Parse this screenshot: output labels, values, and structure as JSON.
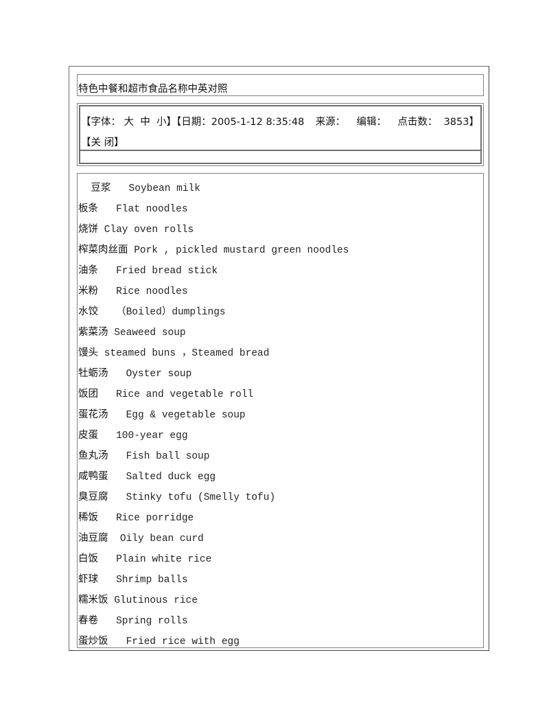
{
  "title": "特色中餐和超市食品名称中英对照",
  "meta": {
    "font_label_open": "【字体：",
    "font_large": "大",
    "font_medium": "中",
    "font_small": "小",
    "font_label_close": "】",
    "date_label": "【日期：2005-1-12 8:35:48",
    "source_label": "来源：",
    "editor_label": "编辑：",
    "clicks_label": "点击数：",
    "clicks_value": "3853】",
    "close_label": "【关 闭】"
  },
  "items": [
    {
      "zh": "    豆浆",
      "gap": "   ",
      "en": "Soybean milk"
    },
    {
      "zh": "板条",
      "gap": "   ",
      "en": "Flat noodles"
    },
    {
      "zh": "烧饼",
      "gap": " ",
      "en": "Clay oven rolls"
    },
    {
      "zh": "榨菜肉丝面",
      "gap": " ",
      "en": "Pork , pickled mustard green noodles"
    },
    {
      "zh": "油条",
      "gap": "   ",
      "en": "Fried bread stick"
    },
    {
      "zh": "米粉",
      "gap": "   ",
      "en": "Rice noodles"
    },
    {
      "zh": "水饺",
      "gap": "   ",
      "en": "（Boiled）dumplings"
    },
    {
      "zh": "紫菜汤",
      "gap": " ",
      "en": "Seaweed soup"
    },
    {
      "zh": "馒头",
      "gap": " ",
      "en": "steamed buns ，Steamed bread"
    },
    {
      "zh": "牡蛎汤",
      "gap": "   ",
      "en": "Oyster soup"
    },
    {
      "zh": "饭团",
      "gap": "   ",
      "en": "Rice and vegetable roll"
    },
    {
      "zh": "蛋花汤",
      "gap": "   ",
      "en": "Egg & vegetable soup"
    },
    {
      "zh": "皮蛋",
      "gap": "   ",
      "en": "100-year egg"
    },
    {
      "zh": "鱼丸汤",
      "gap": "   ",
      "en": "Fish ball soup"
    },
    {
      "zh": "咸鸭蛋",
      "gap": "   ",
      "en": "Salted duck egg"
    },
    {
      "zh": "臭豆腐",
      "gap": "   ",
      "en": "Stinky tofu (Smelly tofu)"
    },
    {
      "zh": "稀饭",
      "gap": "   ",
      "en": "Rice porridge"
    },
    {
      "zh": "油豆腐",
      "gap": "  ",
      "en": "Oily bean curd"
    },
    {
      "zh": "白饭",
      "gap": "   ",
      "en": "Plain white rice"
    },
    {
      "zh": "虾球",
      "gap": "   ",
      "en": "Shrimp balls"
    },
    {
      "zh": "糯米饭",
      "gap": " ",
      "en": "Glutinous rice"
    },
    {
      "zh": "春卷",
      "gap": "   ",
      "en": "Spring rolls"
    },
    {
      "zh": "蛋炒饭",
      "gap": "   ",
      "en": "Fried rice with egg"
    }
  ]
}
